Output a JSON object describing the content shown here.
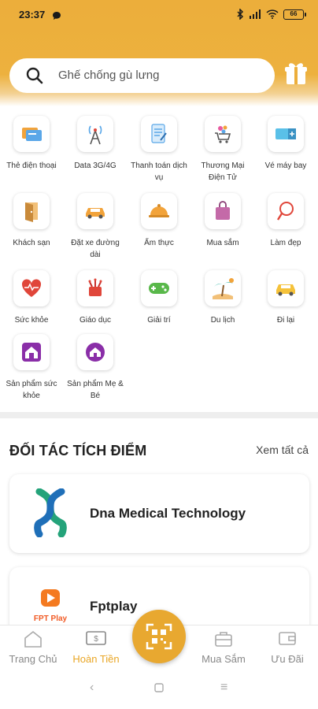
{
  "status": {
    "time": "23:37",
    "battery": "66"
  },
  "search": {
    "placeholder": "Ghế chống gù lưng"
  },
  "categories": [
    {
      "label": "Thẻ điện thoại",
      "icon": "phone-card-icon"
    },
    {
      "label": "Data 3G/4G",
      "icon": "antenna-icon"
    },
    {
      "label": "Thanh toán dịch vụ",
      "icon": "bill-icon"
    },
    {
      "label": "Thương Mại Điện Tử",
      "icon": "cart-icon"
    },
    {
      "label": "Vé máy bay",
      "icon": "ticket-icon"
    },
    {
      "label": "Khách sạn",
      "icon": "door-icon"
    },
    {
      "label": "Đặt xe đường dài",
      "icon": "car-icon"
    },
    {
      "label": "Ẩm thực",
      "icon": "cloche-icon"
    },
    {
      "label": "Mua sắm",
      "icon": "shopping-bag-icon"
    },
    {
      "label": "Làm đẹp",
      "icon": "mirror-icon"
    },
    {
      "label": "Sức khỏe",
      "icon": "heart-pulse-icon"
    },
    {
      "label": "Giáo dục",
      "icon": "education-icon"
    },
    {
      "label": "Giải trí",
      "icon": "gamepad-icon"
    },
    {
      "label": "Du lịch",
      "icon": "beach-icon"
    },
    {
      "label": "Đi lại",
      "icon": "taxi-icon"
    },
    {
      "label": "Sản phẩm sức khỏe",
      "icon": "home-health-icon"
    },
    {
      "label": "Sản phẩm Mẹ & Bé",
      "icon": "home-baby-icon"
    }
  ],
  "partners_section": {
    "title": "ĐỐI TÁC TÍCH ĐIỂM",
    "see_all": "Xem tất cả"
  },
  "partners": [
    {
      "name": "Dna Medical Technology",
      "logo": "dna-logo-icon"
    },
    {
      "name": "Fptplay",
      "logo": "fptplay-logo-icon",
      "logo_text": "FPT Play"
    }
  ],
  "nav": [
    {
      "label": "Trang Chủ",
      "icon": "home-icon"
    },
    {
      "label": "Hoàn Tiền",
      "icon": "cashback-icon"
    },
    {
      "label": "Mua Sắm",
      "icon": "briefcase-icon"
    },
    {
      "label": "Ưu Đãi",
      "icon": "wallet-icon"
    }
  ],
  "colors": {
    "brand": "#ecae3b",
    "active_nav": "#e9a625"
  }
}
